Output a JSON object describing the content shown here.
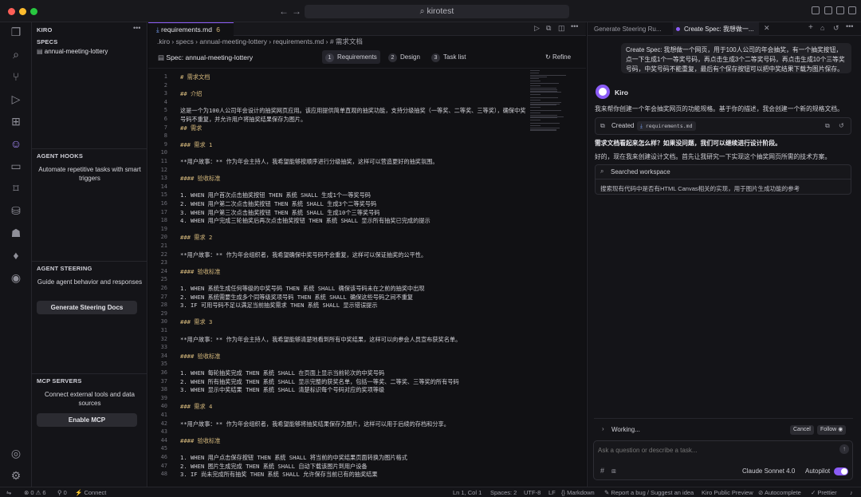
{
  "titlebar": {
    "command_center": "⌕ kirotest"
  },
  "sidebar": {
    "title": "KIRO",
    "specs": {
      "header": "SPECS",
      "items": [
        {
          "label": "annual-meeting-lottery"
        }
      ]
    },
    "agent_hooks": {
      "header": "AGENT HOOKS",
      "description": "Automate repetitive tasks with smart triggers"
    },
    "agent_steering": {
      "header": "AGENT STEERING",
      "description": "Guide agent behavior and responses",
      "button": "Generate Steering Docs"
    },
    "mcp_servers": {
      "header": "MCP SERVERS",
      "description": "Connect external tools and data sources",
      "button": "Enable MCP"
    }
  },
  "editor": {
    "tab": {
      "label": "requirements.md",
      "count": "6"
    },
    "breadcrumb": ".kiro  ›  specs  ›  annual-meeting-lottery  ›  requirements.md  ›  # 需求文档",
    "spec_title": "Spec: annual-meeting-lottery",
    "spec_tabs": [
      {
        "num": "1",
        "label": "Requirements"
      },
      {
        "num": "2",
        "label": "Design"
      },
      {
        "num": "3",
        "label": "Task list"
      }
    ],
    "refine": "Refine",
    "lines": [
      {
        "n": "1",
        "t": "# 需求文档",
        "h": true
      },
      {
        "n": "2",
        "t": ""
      },
      {
        "n": "3",
        "t": "## 介绍",
        "h": true
      },
      {
        "n": "4",
        "t": ""
      },
      {
        "n": "5",
        "t": "这是一个为100人公司年会设计的抽奖网页应用。该应用提供简单直观的抽奖功能，支持分级抽奖（一等奖、二等奖、三等奖），确保中奖"
      },
      {
        "n": "6",
        "t": "号码不重复，并允许用户将抽奖结果保存为图片。"
      },
      {
        "n": "7",
        "t": "## 需求",
        "h": true
      },
      {
        "n": "8",
        "t": ""
      },
      {
        "n": "9",
        "t": "### 需求 1",
        "h": true
      },
      {
        "n": "10",
        "t": ""
      },
      {
        "n": "11",
        "t": "**用户故事：** 作为年会主持人，我希望能够按顺序进行分级抽奖，这样可以营造更好的抽奖氛围。"
      },
      {
        "n": "12",
        "t": ""
      },
      {
        "n": "13",
        "t": "#### 验收标准",
        "h": true
      },
      {
        "n": "14",
        "t": ""
      },
      {
        "n": "15",
        "t": "1. WHEN 用户首次点击抽奖按钮 THEN 系统 SHALL 生成1个一等奖号码"
      },
      {
        "n": "16",
        "t": "2. WHEN 用户第二次点击抽奖按钮 THEN 系统 SHALL 生成3个二等奖号码"
      },
      {
        "n": "17",
        "t": "3. WHEN 用户第三次点击抽奖按钮 THEN 系统 SHALL 生成10个三等奖号码"
      },
      {
        "n": "18",
        "t": "4. WHEN 用户完成三轮抽奖后再次点击抽奖按钮 THEN 系统 SHALL 显示所有抽奖已完成的提示"
      },
      {
        "n": "19",
        "t": ""
      },
      {
        "n": "20",
        "t": "### 需求 2",
        "h": true
      },
      {
        "n": "21",
        "t": ""
      },
      {
        "n": "22",
        "t": "**用户故事：** 作为年会组织者，我希望确保中奖号码不会重复，这样可以保证抽奖的公平性。"
      },
      {
        "n": "23",
        "t": ""
      },
      {
        "n": "24",
        "t": "#### 验收标准",
        "h": true
      },
      {
        "n": "25",
        "t": ""
      },
      {
        "n": "26",
        "t": "1. WHEN 系统生成任何等级的中奖号码 THEN 系统 SHALL 确保该号码未在之前的抽奖中出现"
      },
      {
        "n": "27",
        "t": "2. WHEN 系统需要生成多个同等级奖项号码 THEN 系统 SHALL 确保这些号码之间不重复"
      },
      {
        "n": "28",
        "t": "3. IF 可用号码不足以满足当前抽奖需求 THEN 系统 SHALL 显示错误提示"
      },
      {
        "n": "29",
        "t": ""
      },
      {
        "n": "30",
        "t": "### 需求 3",
        "h": true
      },
      {
        "n": "31",
        "t": ""
      },
      {
        "n": "32",
        "t": "**用户故事：** 作为年会主持人，我希望能够清楚地看到所有中奖结果，这样可以向参会人员宣布获奖名单。"
      },
      {
        "n": "33",
        "t": ""
      },
      {
        "n": "34",
        "t": "#### 验收标准",
        "h": true
      },
      {
        "n": "35",
        "t": ""
      },
      {
        "n": "36",
        "t": "1. WHEN 每轮抽奖完成 THEN 系统 SHALL 在页面上显示当前轮次的中奖号码"
      },
      {
        "n": "37",
        "t": "2. WHEN 所有抽奖完成 THEN 系统 SHALL 显示完整的获奖名单，包括一等奖、二等奖、三等奖的所有号码"
      },
      {
        "n": "38",
        "t": "3. WHEN 显示中奖结果 THEN 系统 SHALL 清楚标识每个号码对应的奖项等级"
      },
      {
        "n": "39",
        "t": ""
      },
      {
        "n": "40",
        "t": "### 需求 4",
        "h": true
      },
      {
        "n": "41",
        "t": ""
      },
      {
        "n": "42",
        "t": "**用户故事：** 作为年会组织者，我希望能够将抽奖结果保存为图片，这样可以用于后续的存档和分享。"
      },
      {
        "n": "43",
        "t": ""
      },
      {
        "n": "44",
        "t": "#### 验收标准",
        "h": true
      },
      {
        "n": "45",
        "t": ""
      },
      {
        "n": "46",
        "t": "1. WHEN 用户点击保存按钮 THEN 系统 SHALL 将当前的中奖结果页面转换为图片格式"
      },
      {
        "n": "47",
        "t": "2. WHEN 图片生成完成 THEN 系统 SHALL 自动下载该图片到用户设备"
      },
      {
        "n": "48",
        "t": "3. IF 尚未完成所有抽奖 THEN 系统 SHALL 允许保存当前已有的抽奖结果"
      }
    ]
  },
  "chat": {
    "tabs": [
      "Generate Steering Ru...",
      "Create Spec: 我想做一..."
    ],
    "user_message": "Create Spec: 我想做一个网页，用于100人公司的年会抽奖，有一个抽奖按钮，点一下生成1个一等奖号码，再点击生成3个二等奖号码，再点击生成10个三等奖号码，中奖号码不能重复，最后有个保存按钮可以把中奖结果下载为图片保存。",
    "assistant_name": "Kiro",
    "intro": "我来帮你创建一个年会抽奖网页的功能规格。基于你的描述，我会创建一个新的规格文档。",
    "created_label": "Created",
    "created_file": "requirements.md",
    "question": "需求文档看起来怎么样？如果没问题，我们可以继续进行设计阶段。",
    "followup": "好的，现在我来创建设计文档。首先让我研究一下实现这个抽奖网页所需的技术方案。",
    "searched_label": "Searched workspace",
    "searched_detail": "搜索现有代码中是否有HTML Canvas相关的实现，用于图片生成功能的参考",
    "working": "Working...",
    "cancel": "Cancel",
    "follow": "Follow",
    "input_placeholder": "Ask a question or describe a task...",
    "model": "Claude Sonnet 4.0",
    "autopilot": "Autopilot"
  },
  "statusbar": {
    "problems": "⊗ 0 ⚠ 6",
    "ports": "⚲ 0",
    "connect": "Connect",
    "position": "Ln 1, Col 1",
    "spaces": "Spaces: 2",
    "encoding": "UTF-8",
    "eol": "LF",
    "language": "Markdown",
    "report": "Report a bug / Suggest an idea",
    "preview": "Kiro Public Preview",
    "autocomplete": "Autocomplete",
    "prettier": "Prettier"
  },
  "colors": {
    "accent": "#8b5cf6",
    "heading": "#d7ba7d"
  }
}
